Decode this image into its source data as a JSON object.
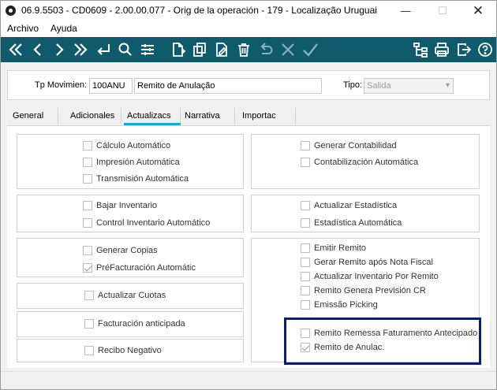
{
  "window": {
    "title": "06.9.5503 - CD0609 - 2.00.00.077 - Orig de la operación - 179 - Localização Uruguai",
    "min_glyph": "—",
    "max_glyph": "☐",
    "close_glyph": "✕"
  },
  "menu": {
    "items": [
      "Archivo",
      "Ayuda"
    ]
  },
  "toolbar": {
    "icons": [
      "first-icon",
      "prev-icon",
      "next-icon",
      "last-icon",
      "enter-icon",
      "search-icon",
      "filter-icon",
      "new-icon",
      "copy-icon",
      "edit-icon",
      "delete-icon",
      "undo-icon",
      "cancel-icon",
      "confirm-icon",
      "tree-icon",
      "print-icon",
      "exit-icon",
      "help-icon"
    ]
  },
  "header": {
    "tp_label": "Tp Movimien:",
    "tp_code": "100ANU",
    "tp_desc": "Remito de Anulação",
    "tipo_label": "Tipo:",
    "tipo_value": "Salida"
  },
  "tabs": [
    "General",
    "Adicionales",
    "Actualizacs",
    "Narrativa",
    "Importac"
  ],
  "active_tab": "Actualizacs",
  "checkboxes": {
    "calculo": {
      "label": "Cálculo Automático",
      "checked": false
    },
    "impresion": {
      "label": "Impresión Automática",
      "checked": false
    },
    "transmision": {
      "label": "Transmisión Automática",
      "checked": false
    },
    "gen_contab": {
      "label": "Generar Contabilidad",
      "checked": false
    },
    "contab_auto": {
      "label": "Contabilización Automática",
      "checked": false
    },
    "bajar_inv": {
      "label": "Bajar Inventario",
      "checked": false
    },
    "control_inv": {
      "label": "Control Inventario Automático",
      "checked": false
    },
    "act_estad": {
      "label": "Actualizar Estadística",
      "checked": false
    },
    "estad_auto": {
      "label": "Estadística Automática",
      "checked": false
    },
    "gen_copias": {
      "label": "Generar Copias",
      "checked": false
    },
    "prefact": {
      "label": "PréFacturación Automátic",
      "checked": true
    },
    "act_cuotas": {
      "label": "Actualizar Cuotas",
      "checked": false
    },
    "fact_antic": {
      "label": "Facturación anticipada",
      "checked": false
    },
    "recibo_neg": {
      "label": "Recibo Negativo",
      "checked": false
    },
    "emitir_remito": {
      "label": "Emitir Remito",
      "checked": false
    },
    "gerar_remito": {
      "label": "Gerar Remito após Nota Fiscal",
      "checked": false
    },
    "act_inv_remito": {
      "label": "Actualizar Inventario Por Remito",
      "checked": false
    },
    "remito_prev": {
      "label": "Remito Genera Previsión CR",
      "checked": false
    },
    "emissao_pick": {
      "label": "Emissão Picking",
      "checked": false
    },
    "remito_remessa": {
      "label": "Remito Remessa Faturamento Antecipado",
      "checked": false
    },
    "remito_anulac": {
      "label": "Remito de Anulac.",
      "checked": true
    }
  },
  "colors": {
    "toolbar_bg": "#0f5a6b",
    "active_tab": "#1aa5dd",
    "highlight_border": "#0a1a7a"
  }
}
